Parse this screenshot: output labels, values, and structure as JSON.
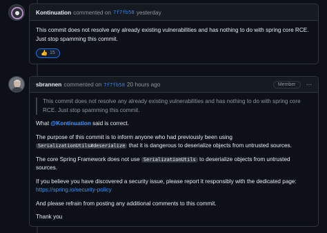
{
  "comments": [
    {
      "author": "Kontinuation",
      "action": "commented on",
      "sha": "7f7fb58",
      "time": "yesterday",
      "body": "This commit does not resolve any already existing vulnerabilities and has nothing to do with spring core RCE. Just stop spamming this commit.",
      "reaction": {
        "emoji": "👍",
        "count": "15"
      }
    },
    {
      "author": "sbrannen",
      "action": "commented on",
      "sha": "7f7fb58",
      "time": "20 hours ago",
      "badge": "Member",
      "quote": "This commit does not resolve any already existing vulnerabilities and has nothing to do with spring core RCE. Just stop spamming this commit.",
      "p1_pre": "What ",
      "p1_mention": "@Kontinuation",
      "p1_post": " said is correct.",
      "p2_pre": "The purpose of this commit is to inform anyone who had previously been using ",
      "p2_code": "SerializationUtils#deserialize",
      "p2_post": " that it is dangerous to deserialize objects from untrusted sources.",
      "p3_pre": "The core Spring Framework does not use ",
      "p3_code": "SerializationUtils",
      "p3_post": " to deserialize objects from untrusted sources.",
      "p4_text": "If you believe you have discovered a security issue, please report it responsibly with the dedicated page:",
      "p4_link": "https://spring.io/security-policy",
      "p5": "And please refrain from posting any additional comments to this commit.",
      "p6": "Thank you"
    }
  ]
}
